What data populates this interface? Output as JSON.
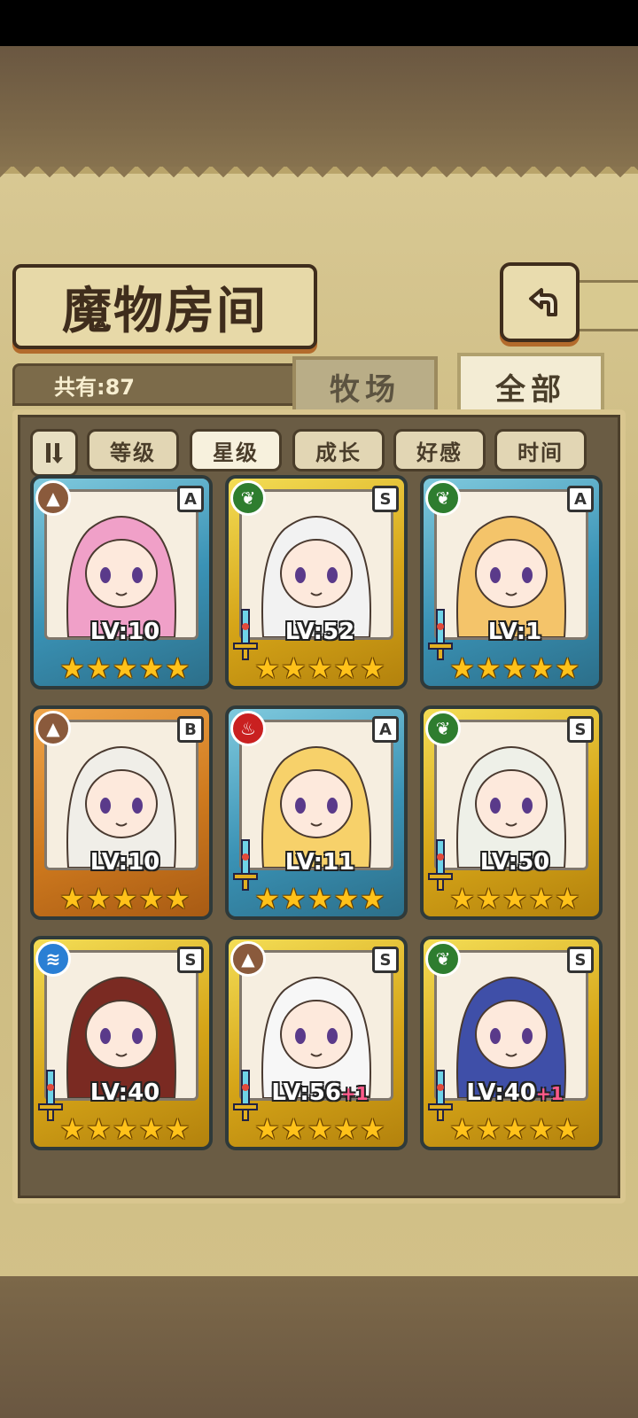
{
  "header": {
    "title": "魔物房间",
    "back_icon": "return-arrow-icon"
  },
  "summary": {
    "count_label": "共有:87"
  },
  "tabs": [
    {
      "label": "牧场",
      "active": false
    },
    {
      "label": "全部",
      "active": true
    }
  ],
  "sort": {
    "toggle_icon": "sort-order-icon",
    "options": [
      {
        "label": "等级",
        "selected": false
      },
      {
        "label": "星级",
        "selected": true
      },
      {
        "label": "成长",
        "selected": false
      },
      {
        "label": "好感",
        "selected": false
      },
      {
        "label": "时间",
        "selected": false
      }
    ]
  },
  "monsters": [
    {
      "frame": "blue",
      "element": "earth",
      "rank": "A",
      "level": "LV:10",
      "plus": "",
      "stars": 5,
      "sword": false,
      "hair": "#f0a0c8"
    },
    {
      "frame": "gold",
      "element": "wood",
      "rank": "S",
      "level": "LV:52",
      "plus": "",
      "stars": 5,
      "sword": true,
      "hair": "#f2f2f2"
    },
    {
      "frame": "blue",
      "element": "wood",
      "rank": "A",
      "level": "LV:1",
      "plus": "",
      "stars": 5,
      "sword": true,
      "hair": "#f4c46a"
    },
    {
      "frame": "bronze",
      "element": "earth",
      "rank": "B",
      "level": "LV:10",
      "plus": "",
      "stars": 5,
      "sword": false,
      "hair": "#f0eee8"
    },
    {
      "frame": "blue",
      "element": "fire",
      "rank": "A",
      "level": "LV:11",
      "plus": "",
      "stars": 5,
      "sword": true,
      "hair": "#f7d16a"
    },
    {
      "frame": "gold",
      "element": "wood",
      "rank": "S",
      "level": "LV:50",
      "plus": "",
      "stars": 5,
      "sword": true,
      "hair": "#eef0e8"
    },
    {
      "frame": "gold",
      "element": "water",
      "rank": "S",
      "level": "LV:40",
      "plus": "",
      "stars": 5,
      "sword": true,
      "hair": "#7a2a22"
    },
    {
      "frame": "gold",
      "element": "earth",
      "rank": "S",
      "level": "LV:56",
      "plus": "+1",
      "stars": 5,
      "sword": true,
      "hair": "#f7f7f7"
    },
    {
      "frame": "gold",
      "element": "wood",
      "rank": "S",
      "level": "LV:40",
      "plus": "+1",
      "stars": 5,
      "sword": true,
      "hair": "#3f4fa8"
    }
  ]
}
